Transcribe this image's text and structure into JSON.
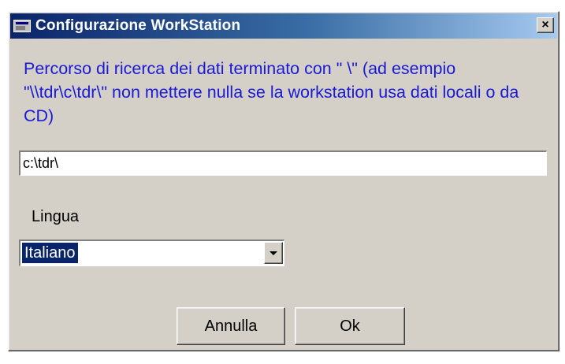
{
  "window": {
    "title": "Configurazione WorkStation",
    "close_label": "×"
  },
  "form": {
    "description": "Percorso di ricerca dei dati terminato con \" \\\" (ad esempio \"\\\\tdr\\c\\tdr\\\" non mettere nulla se la workstation usa dati locali o da CD)",
    "path_value": "c:\\tdr\\",
    "language_label": "Lingua",
    "language_selected": "Italiano"
  },
  "buttons": {
    "cancel_label": "Annulla",
    "ok_label": "Ok"
  },
  "icons": {
    "app": "app-window-icon",
    "dropdown": "chevron-down-icon"
  },
  "colors": {
    "titlebar_start": "#0a246a",
    "titlebar_end": "#a6caf0",
    "window_bg": "#d4d0c8",
    "description_text": "#1a1ad4",
    "selection_bg": "#0a246a"
  }
}
